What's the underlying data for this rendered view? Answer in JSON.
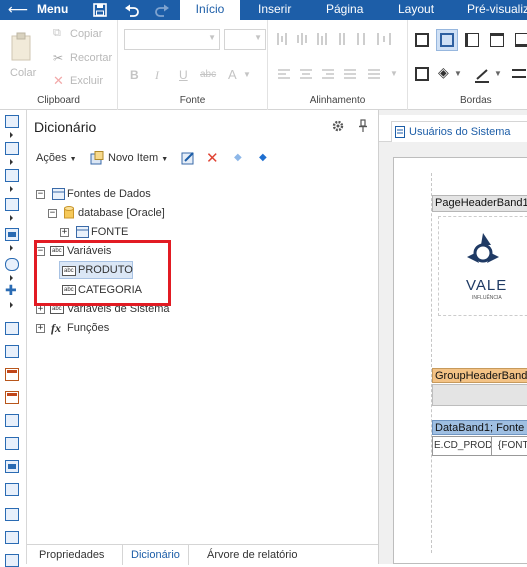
{
  "topbar": {
    "menu": "Menu",
    "tabs": [
      "Início",
      "Inserir",
      "Página",
      "Layout",
      "Pré-visualiz"
    ]
  },
  "ribbon": {
    "clipboard": {
      "name": "Clipboard",
      "paste": "Colar",
      "copy": "Copiar",
      "cut": "Recortar",
      "delete": "Excluir"
    },
    "font": {
      "name": "Fonte"
    },
    "alignment": {
      "name": "Alinhamento"
    },
    "borders": {
      "name": "Bordas"
    }
  },
  "dictionary": {
    "title": "Dicionário",
    "actions_label": "Ações",
    "new_item_label": "Novo Item",
    "tree": {
      "data_sources": "Fontes de Dados",
      "database": "database [Oracle]",
      "source": "FONTE",
      "variables": "Variáveis",
      "var_produto": "PRODUTO",
      "var_categoria": "CATEGORIA",
      "system_variables": "Variáveis de Sistema",
      "functions": "Funções",
      "abc_badge": "abc",
      "fx": "fx"
    },
    "tabs": [
      "Propriedades",
      "Dicionário",
      "Árvore de relatório"
    ]
  },
  "designer": {
    "tab": "Usuários do Sistema",
    "page_header_band": "PageHeaderBand1",
    "group_header_band": "GroupHeaderBand",
    "data_band": "DataBand1; Fonte",
    "cell1": "E.CD_PROD",
    "cell2": "{FONT",
    "logo_text": "VALE",
    "logo_sub": "INFLUÊNCIA"
  },
  "colors": {
    "primary": "#1d5ea8",
    "highlight": "#e21b23",
    "band_orange": "#f3c285",
    "band_blue": "#9fbfe2"
  }
}
